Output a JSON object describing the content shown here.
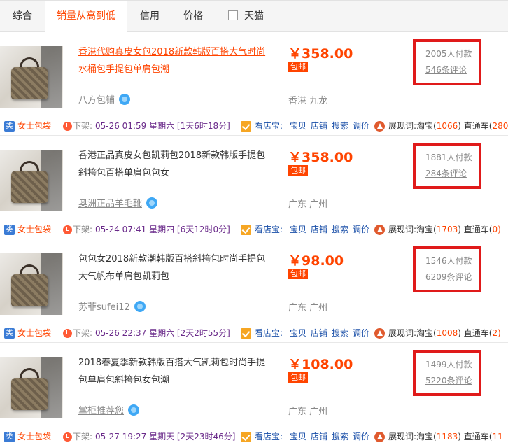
{
  "sortbar": {
    "tabs": [
      "综合",
      "销量从高到低",
      "信用",
      "价格"
    ],
    "tmall_label": "天猫",
    "accent": "#ff4400"
  },
  "items": [
    {
      "title_line1": "香港代购真皮女包2018新款韩版百搭大气时尚",
      "title_line2": "水桶包手提包单肩包潮",
      "shop": "八方包铺",
      "price": "￥358.00",
      "free_shipping": "包邮",
      "location": "香港 九龙",
      "sales": "2005人付款",
      "comments": "546条评论",
      "category": "女士包袋",
      "offline_label": "下架:",
      "offline_time": "05-26 01:59 星期六 [1天6时18分]",
      "shop_tool_label": "看店宝:",
      "tools": [
        "宝贝",
        "店铺",
        "搜索",
        "调价"
      ],
      "keywords_label": "展现词:",
      "taobao_label": "淘宝(",
      "taobao_count": "1066",
      "taobao_close": ")",
      "ztc_label": "直通车(",
      "ztc_count": "280"
    },
    {
      "title_line1": "香港正品真皮女包凯莉包2018新款韩版手提包",
      "title_line2": "斜挎包百搭单肩包包女",
      "shop": "奥洲正品羊毛靴",
      "price": "￥358.00",
      "free_shipping": "包邮",
      "location": "广东 广州",
      "sales": "1881人付款",
      "comments": "284条评论",
      "category": "女士包袋",
      "offline_label": "下架:",
      "offline_time": "05-24 07:41 星期四 [6天12时0分]",
      "shop_tool_label": "看店宝:",
      "tools": [
        "宝贝",
        "店铺",
        "搜索",
        "调价"
      ],
      "keywords_label": "展现词:",
      "taobao_label": "淘宝(",
      "taobao_count": "1703",
      "taobao_close": ")",
      "ztc_label": "直通车(",
      "ztc_count": "0)"
    },
    {
      "title_line1": "包包女2018新款潮韩版百搭斜挎包时尚手提包",
      "title_line2": "大气帆布单肩包凯莉包",
      "shop": "苏菲sufei12",
      "price": "￥98.00",
      "free_shipping": "包邮",
      "location": "广东 广州",
      "sales": "1546人付款",
      "comments": "6209条评论",
      "category": "女士包袋",
      "offline_label": "下架:",
      "offline_time": "05-26 22:37 星期六 [2天2时55分]",
      "shop_tool_label": "看店宝:",
      "tools": [
        "宝贝",
        "店铺",
        "搜索",
        "调价"
      ],
      "keywords_label": "展现词:",
      "taobao_label": "淘宝(",
      "taobao_count": "1008",
      "taobao_close": ")",
      "ztc_label": "直通车(",
      "ztc_count": "2)"
    },
    {
      "title_line1": "2018春夏季新款韩版百搭大气凯莉包时尚手提",
      "title_line2": "包单肩包斜挎包女包潮",
      "shop": "掌柜推荐您",
      "price": "￥108.00",
      "free_shipping": "包邮",
      "location": "广东 广州",
      "sales": "1499人付款",
      "comments": "5220条评论",
      "category": "女士包袋",
      "offline_label": "下架:",
      "offline_time": "05-27 19:27 星期天 [2天23时46分]",
      "shop_tool_label": "看店宝:",
      "tools": [
        "宝贝",
        "店铺",
        "搜索",
        "调价"
      ],
      "keywords_label": "展现词:",
      "taobao_label": "淘宝(",
      "taobao_count": "1183",
      "taobao_close": ")",
      "ztc_label": "直通车(",
      "ztc_count": "11"
    }
  ]
}
